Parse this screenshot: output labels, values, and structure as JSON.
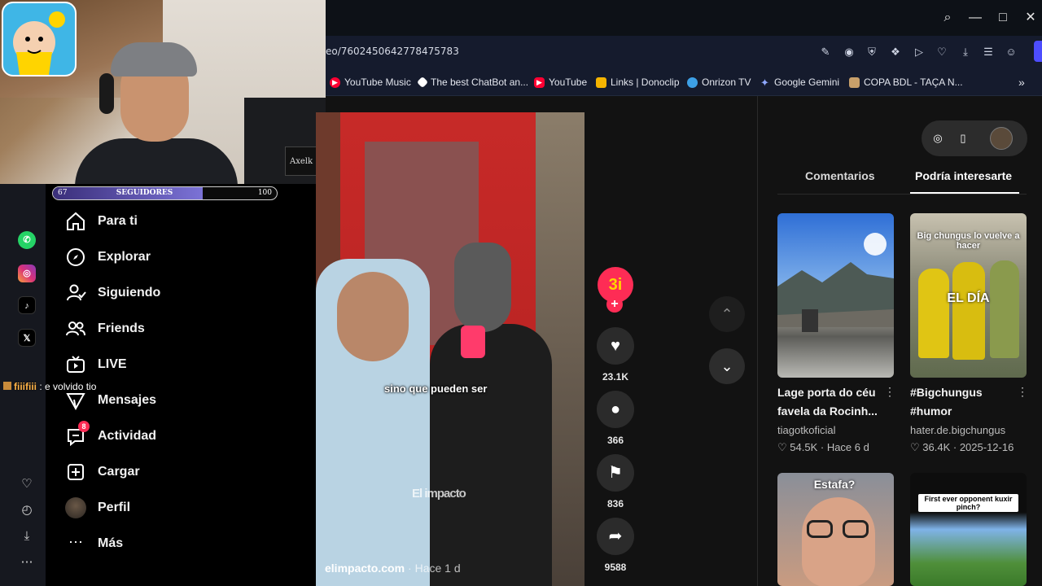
{
  "browser": {
    "url": "eo/7602450642778475783",
    "bookmarks": [
      {
        "label": "YouTube Music",
        "icon": "youtube-music-icon",
        "color": "#ff0033"
      },
      {
        "label": "The best ChatBot an...",
        "icon": "chatbot-icon",
        "color": "#ffffff"
      },
      {
        "label": "YouTube",
        "icon": "youtube-icon",
        "color": "#ff0033"
      },
      {
        "label": "Links | Donoclip",
        "icon": "donoclip-icon",
        "color": "#f5b400"
      },
      {
        "label": "Onrizon TV",
        "icon": "onrizon-icon",
        "color": "#3da0e6"
      },
      {
        "label": "Google Gemini",
        "icon": "gemini-icon",
        "color": "#6b8cff"
      },
      {
        "label": "COPA BDL - TAÇA N...",
        "icon": "copa-icon",
        "color": "#c8a06a"
      }
    ]
  },
  "stream_overlay": {
    "followers": {
      "label": "SEGUIDORES",
      "current": "67",
      "goal": "100",
      "progress": 0.67
    },
    "chat": {
      "user": "fiiifiii",
      "message": ": e volvido tio"
    },
    "webcam_watermark": "Axelk"
  },
  "sidebar": {
    "items": [
      {
        "label": "Para ti",
        "icon": "home-icon"
      },
      {
        "label": "Explorar",
        "icon": "compass-icon"
      },
      {
        "label": "Siguiendo",
        "icon": "following-icon"
      },
      {
        "label": "Friends",
        "icon": "friends-icon"
      },
      {
        "label": "LIVE",
        "icon": "live-icon"
      },
      {
        "label": "Mensajes",
        "icon": "messages-icon"
      },
      {
        "label": "Actividad",
        "icon": "activity-icon",
        "badge": "8"
      },
      {
        "label": "Cargar",
        "icon": "upload-icon"
      },
      {
        "label": "Perfil",
        "icon": "profile-avatar"
      },
      {
        "label": "Más",
        "icon": "more-icon"
      }
    ]
  },
  "video": {
    "caption": "sino que pueden ser",
    "watermark": "El impacto",
    "author": "elimpacto.com",
    "when": "· Hace 1 d",
    "likes": "23.1K",
    "comments": "366",
    "saves": "836",
    "shares": "9588"
  },
  "right_panel": {
    "tabs": [
      "Comentarios",
      "Podría interesarte"
    ],
    "active_tab": "Podría interesarte",
    "cards": [
      {
        "title": "Lage porta do céu favela da Rocinh...",
        "author": "tiagotkoficial",
        "likes": "♡ 54.5K",
        "date": "· Hace 6 d",
        "thumb_text": ""
      },
      {
        "title": "#Bigchungus #humor",
        "author": "hater.de.bigchungus",
        "likes": "♡ 36.4K",
        "date": "· 2025-12-16",
        "thumb_text": "Big chungus lo vuelve a hacer",
        "thumb_text2": "EL DÍA"
      },
      {
        "title": "",
        "author": "",
        "likes": "",
        "date": "",
        "thumb_text": "Estafa?"
      },
      {
        "title": "",
        "author": "",
        "likes": "",
        "date": "",
        "thumb_text": "First ever opponent kuxir pinch?"
      }
    ]
  }
}
